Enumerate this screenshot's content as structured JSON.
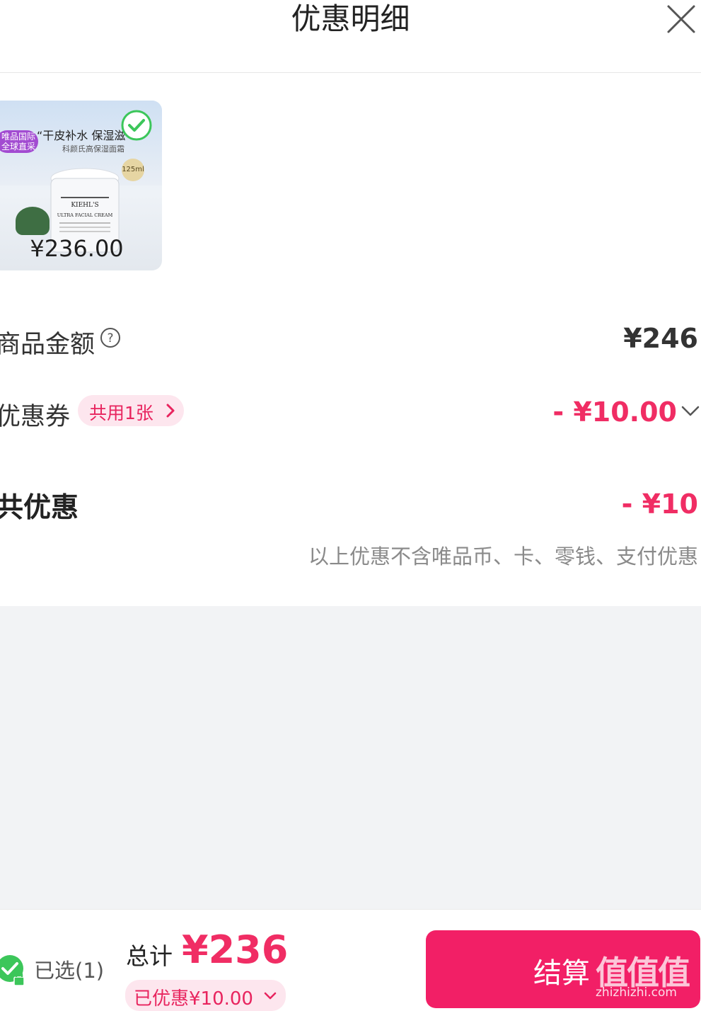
{
  "header": {
    "title": "优惠明细",
    "close_icon": "close-icon"
  },
  "product": {
    "tag_line1": "唯品国际",
    "tag_line2": "全球直采",
    "headline": "“干皮补水 保湿滋",
    "subtitle": "科颜氏高保湿面霜",
    "size_badge": "125ml",
    "jar_brand": "KIEHL'S",
    "jar_name": "ULTRA FACIAL CREAM",
    "price": "¥236.00",
    "selected": true
  },
  "rows": {
    "goods_label": "商品金额",
    "goods_amount": "¥246",
    "coupon_label": "优惠券",
    "coupon_tag": "共用1张",
    "coupon_amount": "- ¥10.00",
    "total_label": "共优惠",
    "total_amount": "- ¥10",
    "note": "以上优惠不含唯品币、卡、零钱、支付优惠"
  },
  "footer": {
    "selected_text": "已选(1)",
    "sum_label": "总计",
    "sum_value": "¥236",
    "saved_text": "已优惠¥10.00",
    "checkout_label": "结算",
    "watermark": "值值值",
    "watermark_url": "zhizhizhi.com"
  },
  "colors": {
    "accent": "#f02d64",
    "checkout": "#f21f66",
    "pill_bg": "#fde6ee",
    "check_green": "#3cc65a"
  }
}
